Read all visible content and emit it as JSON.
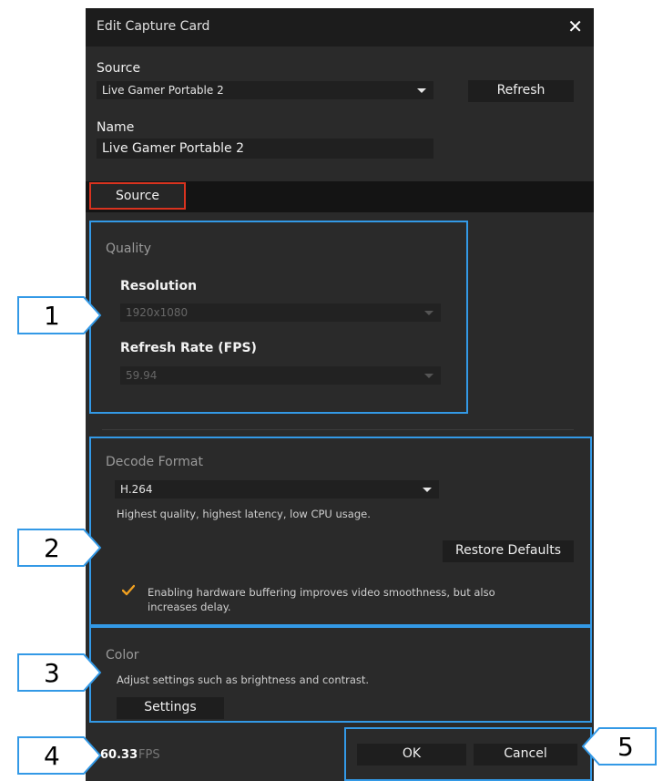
{
  "dialog": {
    "title": "Edit Capture Card",
    "close_icon": "close-icon",
    "source_label": "Source",
    "source_value": "Live Gamer Portable 2",
    "refresh_label": "Refresh",
    "name_label": "Name",
    "name_value": "Live Gamer Portable 2"
  },
  "tabs": [
    {
      "label": "Source",
      "active": true
    }
  ],
  "quality": {
    "title": "Quality",
    "resolution_label": "Resolution",
    "resolution_value": "1920x1080",
    "refresh_rate_label": "Refresh Rate (FPS)",
    "refresh_rate_value": "59.94"
  },
  "decode": {
    "title": "Decode Format",
    "value": "H.264",
    "description": "Highest quality, highest latency, low CPU usage.",
    "restore_label": "Restore Defaults",
    "buffering_checked": true,
    "buffering_text_1": "Enabling hardware buffering improves video smoothness, but also",
    "buffering_text_2": "increases delay."
  },
  "color": {
    "title": "Color",
    "description": "Adjust settings such as brightness and contrast.",
    "settings_label": "Settings"
  },
  "footer": {
    "fps_value": "60.33",
    "fps_unit": "FPS",
    "ok_label": "OK",
    "cancel_label": "Cancel"
  },
  "callouts": [
    "1",
    "2",
    "3",
    "4",
    "5"
  ],
  "colors": {
    "highlight": "#3399e6",
    "tab_border": "#d9331f",
    "checkmark": "#f0a020",
    "dialog_bg": "#2a2a2a"
  }
}
